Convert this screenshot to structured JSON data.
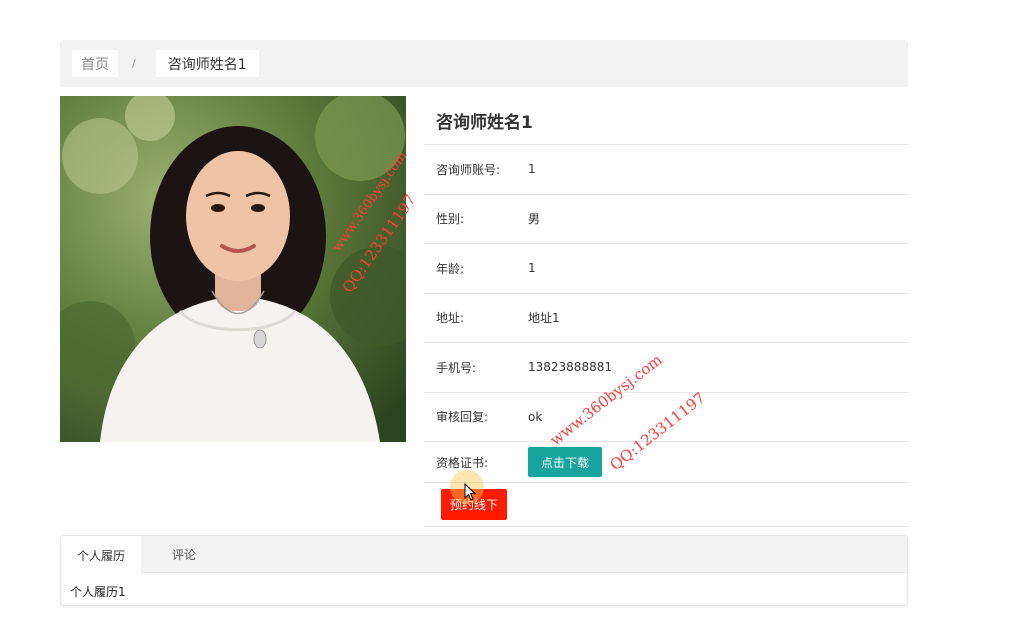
{
  "breadcrumb": {
    "home": "首页",
    "separator": "/",
    "current": "咨询师姓名1"
  },
  "profile": {
    "name": "咨询师姓名1",
    "fields": [
      {
        "label": "咨询师账号:",
        "value": "1"
      },
      {
        "label": "性别:",
        "value": "男"
      },
      {
        "label": "年龄:",
        "value": "1"
      },
      {
        "label": "地址:",
        "value": "地址1"
      },
      {
        "label": "手机号:",
        "value": "13823888881"
      },
      {
        "label": "审核回复:",
        "value": "ok"
      }
    ],
    "certificate_label": "资格证书:",
    "download_button": "点击下载",
    "book_button": "预约线下"
  },
  "tabs": [
    {
      "label": "个人履历",
      "active": true
    },
    {
      "label": "评论",
      "active": false
    }
  ],
  "tab_content": "个人履历1",
  "watermarks": {
    "site": "www.360bysj.com",
    "qq": "QQ:123311197"
  },
  "colors": {
    "download": "#16a49c",
    "book": "#ff1a00",
    "watermark": "#ff3b3b"
  }
}
